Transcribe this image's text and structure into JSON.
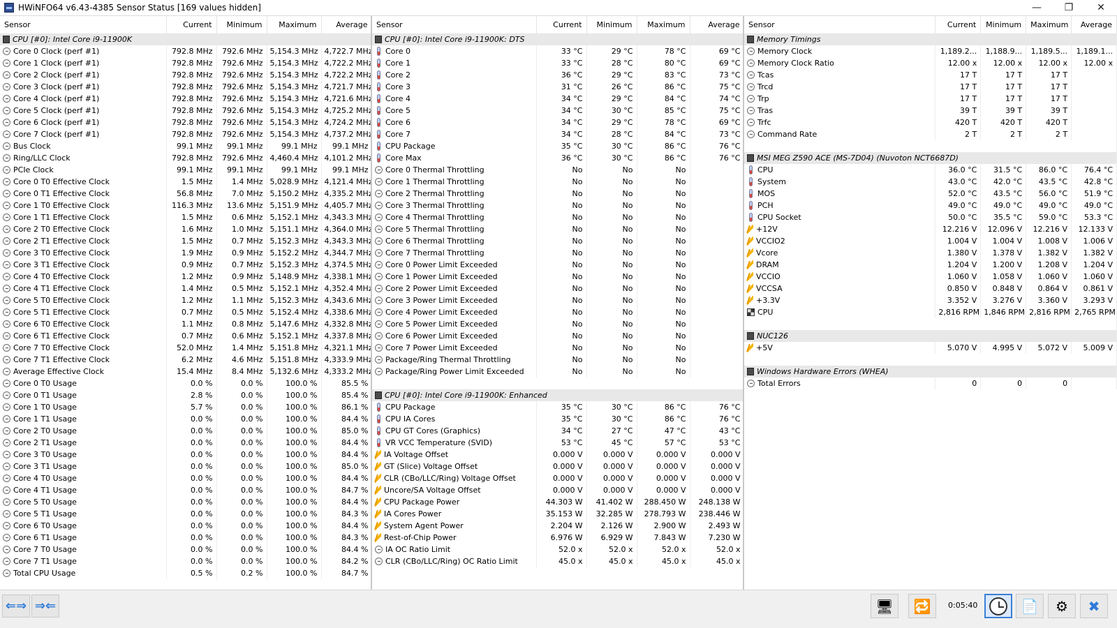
{
  "window": {
    "title": "HWiNFO64 v6.43-4385 Sensor Status [169 values hidden]",
    "minimize": "—",
    "maximize": "❐",
    "close": "✕"
  },
  "columns": [
    "Sensor",
    "Current",
    "Minimum",
    "Maximum",
    "Average"
  ],
  "pane1": [
    {
      "type": "group",
      "name": "CPU [#0]: Intel Core i9-11900K"
    },
    {
      "icon": "clock",
      "name": "Core 0 Clock (perf #1)",
      "cur": "792.8 MHz",
      "min": "792.6 MHz",
      "max": "5,154.3 MHz",
      "avg": "4,722.7 MHz"
    },
    {
      "icon": "clock",
      "name": "Core 1 Clock (perf #1)",
      "cur": "792.8 MHz",
      "min": "792.6 MHz",
      "max": "5,154.3 MHz",
      "avg": "4,722.2 MHz"
    },
    {
      "icon": "clock",
      "name": "Core 2 Clock (perf #1)",
      "cur": "792.8 MHz",
      "min": "792.6 MHz",
      "max": "5,154.3 MHz",
      "avg": "4,722.2 MHz"
    },
    {
      "icon": "clock",
      "name": "Core 3 Clock (perf #1)",
      "cur": "792.8 MHz",
      "min": "792.6 MHz",
      "max": "5,154.3 MHz",
      "avg": "4,721.7 MHz"
    },
    {
      "icon": "clock",
      "name": "Core 4 Clock (perf #1)",
      "cur": "792.8 MHz",
      "min": "792.6 MHz",
      "max": "5,154.3 MHz",
      "avg": "4,721.6 MHz"
    },
    {
      "icon": "clock",
      "name": "Core 5 Clock (perf #1)",
      "cur": "792.8 MHz",
      "min": "792.6 MHz",
      "max": "5,154.3 MHz",
      "avg": "4,725.2 MHz"
    },
    {
      "icon": "clock",
      "name": "Core 6 Clock (perf #1)",
      "cur": "792.8 MHz",
      "min": "792.6 MHz",
      "max": "5,154.3 MHz",
      "avg": "4,724.2 MHz"
    },
    {
      "icon": "clock",
      "name": "Core 7 Clock (perf #1)",
      "cur": "792.8 MHz",
      "min": "792.6 MHz",
      "max": "5,154.3 MHz",
      "avg": "4,737.2 MHz"
    },
    {
      "icon": "clock",
      "name": "Bus Clock",
      "cur": "99.1 MHz",
      "min": "99.1 MHz",
      "max": "99.1 MHz",
      "avg": "99.1 MHz"
    },
    {
      "icon": "clock",
      "name": "Ring/LLC Clock",
      "cur": "792.8 MHz",
      "min": "792.6 MHz",
      "max": "4,460.4 MHz",
      "avg": "4,101.2 MHz"
    },
    {
      "icon": "clock",
      "name": "PCIe Clock",
      "cur": "99.1 MHz",
      "min": "99.1 MHz",
      "max": "99.1 MHz",
      "avg": "99.1 MHz"
    },
    {
      "icon": "clock",
      "name": "Core 0 T0 Effective Clock",
      "cur": "1.5 MHz",
      "min": "1.4 MHz",
      "max": "5,028.9 MHz",
      "avg": "4,121.4 MHz"
    },
    {
      "icon": "clock",
      "name": "Core 0 T1 Effective Clock",
      "cur": "56.8 MHz",
      "min": "7.0 MHz",
      "max": "5,150.2 MHz",
      "avg": "4,335.2 MHz"
    },
    {
      "icon": "clock",
      "name": "Core 1 T0 Effective Clock",
      "cur": "116.3 MHz",
      "min": "13.6 MHz",
      "max": "5,151.9 MHz",
      "avg": "4,405.7 MHz"
    },
    {
      "icon": "clock",
      "name": "Core 1 T1 Effective Clock",
      "cur": "1.5 MHz",
      "min": "0.6 MHz",
      "max": "5,152.1 MHz",
      "avg": "4,343.3 MHz"
    },
    {
      "icon": "clock",
      "name": "Core 2 T0 Effective Clock",
      "cur": "1.6 MHz",
      "min": "1.0 MHz",
      "max": "5,151.1 MHz",
      "avg": "4,364.0 MHz"
    },
    {
      "icon": "clock",
      "name": "Core 2 T1 Effective Clock",
      "cur": "1.5 MHz",
      "min": "0.7 MHz",
      "max": "5,152.3 MHz",
      "avg": "4,343.3 MHz"
    },
    {
      "icon": "clock",
      "name": "Core 3 T0 Effective Clock",
      "cur": "1.9 MHz",
      "min": "0.9 MHz",
      "max": "5,152.2 MHz",
      "avg": "4,344.7 MHz"
    },
    {
      "icon": "clock",
      "name": "Core 3 T1 Effective Clock",
      "cur": "0.9 MHz",
      "min": "0.7 MHz",
      "max": "5,152.3 MHz",
      "avg": "4,374.5 MHz"
    },
    {
      "icon": "clock",
      "name": "Core 4 T0 Effective Clock",
      "cur": "1.2 MHz",
      "min": "0.9 MHz",
      "max": "5,148.9 MHz",
      "avg": "4,338.1 MHz"
    },
    {
      "icon": "clock",
      "name": "Core 4 T1 Effective Clock",
      "cur": "1.4 MHz",
      "min": "0.5 MHz",
      "max": "5,152.1 MHz",
      "avg": "4,352.4 MHz"
    },
    {
      "icon": "clock",
      "name": "Core 5 T0 Effective Clock",
      "cur": "1.2 MHz",
      "min": "1.1 MHz",
      "max": "5,152.3 MHz",
      "avg": "4,343.6 MHz"
    },
    {
      "icon": "clock",
      "name": "Core 5 T1 Effective Clock",
      "cur": "0.7 MHz",
      "min": "0.5 MHz",
      "max": "5,152.4 MHz",
      "avg": "4,338.6 MHz"
    },
    {
      "icon": "clock",
      "name": "Core 6 T0 Effective Clock",
      "cur": "1.1 MHz",
      "min": "0.8 MHz",
      "max": "5,147.6 MHz",
      "avg": "4,332.8 MHz"
    },
    {
      "icon": "clock",
      "name": "Core 6 T1 Effective Clock",
      "cur": "0.7 MHz",
      "min": "0.6 MHz",
      "max": "5,152.1 MHz",
      "avg": "4,337.8 MHz"
    },
    {
      "icon": "clock",
      "name": "Core 7 T0 Effective Clock",
      "cur": "52.0 MHz",
      "min": "1.4 MHz",
      "max": "5,151.8 MHz",
      "avg": "4,321.1 MHz"
    },
    {
      "icon": "clock",
      "name": "Core 7 T1 Effective Clock",
      "cur": "6.2 MHz",
      "min": "4.6 MHz",
      "max": "5,151.8 MHz",
      "avg": "4,333.9 MHz"
    },
    {
      "icon": "clock",
      "name": "Average Effective Clock",
      "cur": "15.4 MHz",
      "min": "8.4 MHz",
      "max": "5,132.6 MHz",
      "avg": "4,333.2 MHz"
    },
    {
      "icon": "clock",
      "name": "Core 0 T0 Usage",
      "cur": "0.0 %",
      "min": "0.0 %",
      "max": "100.0 %",
      "avg": "85.5 %"
    },
    {
      "icon": "clock",
      "name": "Core 0 T1 Usage",
      "cur": "2.8 %",
      "min": "0.0 %",
      "max": "100.0 %",
      "avg": "85.4 %"
    },
    {
      "icon": "clock",
      "name": "Core 1 T0 Usage",
      "cur": "5.7 %",
      "min": "0.0 %",
      "max": "100.0 %",
      "avg": "86.1 %"
    },
    {
      "icon": "clock",
      "name": "Core 1 T1 Usage",
      "cur": "0.0 %",
      "min": "0.0 %",
      "max": "100.0 %",
      "avg": "84.4 %"
    },
    {
      "icon": "clock",
      "name": "Core 2 T0 Usage",
      "cur": "0.0 %",
      "min": "0.0 %",
      "max": "100.0 %",
      "avg": "85.0 %"
    },
    {
      "icon": "clock",
      "name": "Core 2 T1 Usage",
      "cur": "0.0 %",
      "min": "0.0 %",
      "max": "100.0 %",
      "avg": "84.4 %"
    },
    {
      "icon": "clock",
      "name": "Core 3 T0 Usage",
      "cur": "0.0 %",
      "min": "0.0 %",
      "max": "100.0 %",
      "avg": "84.4 %"
    },
    {
      "icon": "clock",
      "name": "Core 3 T1 Usage",
      "cur": "0.0 %",
      "min": "0.0 %",
      "max": "100.0 %",
      "avg": "85.0 %"
    },
    {
      "icon": "clock",
      "name": "Core 4 T0 Usage",
      "cur": "0.0 %",
      "min": "0.0 %",
      "max": "100.0 %",
      "avg": "84.4 %"
    },
    {
      "icon": "clock",
      "name": "Core 4 T1 Usage",
      "cur": "0.0 %",
      "min": "0.0 %",
      "max": "100.0 %",
      "avg": "84.7 %"
    },
    {
      "icon": "clock",
      "name": "Core 5 T0 Usage",
      "cur": "0.0 %",
      "min": "0.0 %",
      "max": "100.0 %",
      "avg": "84.4 %"
    },
    {
      "icon": "clock",
      "name": "Core 5 T1 Usage",
      "cur": "0.0 %",
      "min": "0.0 %",
      "max": "100.0 %",
      "avg": "84.3 %"
    },
    {
      "icon": "clock",
      "name": "Core 6 T0 Usage",
      "cur": "0.0 %",
      "min": "0.0 %",
      "max": "100.0 %",
      "avg": "84.4 %"
    },
    {
      "icon": "clock",
      "name": "Core 6 T1 Usage",
      "cur": "0.0 %",
      "min": "0.0 %",
      "max": "100.0 %",
      "avg": "84.3 %"
    },
    {
      "icon": "clock",
      "name": "Core 7 T0 Usage",
      "cur": "0.0 %",
      "min": "0.0 %",
      "max": "100.0 %",
      "avg": "84.4 %"
    },
    {
      "icon": "clock",
      "name": "Core 7 T1 Usage",
      "cur": "0.0 %",
      "min": "0.0 %",
      "max": "100.0 %",
      "avg": "84.2 %"
    },
    {
      "icon": "clock",
      "name": "Total CPU Usage",
      "cur": "0.5 %",
      "min": "0.2 %",
      "max": "100.0 %",
      "avg": "84.7 %"
    }
  ],
  "pane2": [
    {
      "type": "group",
      "name": "CPU [#0]: Intel Core i9-11900K: DTS"
    },
    {
      "icon": "temp",
      "name": "Core 0",
      "cur": "33 °C",
      "min": "29 °C",
      "max": "78 °C",
      "avg": "69 °C"
    },
    {
      "icon": "temp",
      "name": "Core 1",
      "cur": "33 °C",
      "min": "28 °C",
      "max": "80 °C",
      "avg": "69 °C"
    },
    {
      "icon": "temp",
      "name": "Core 2",
      "cur": "36 °C",
      "min": "29 °C",
      "max": "83 °C",
      "avg": "73 °C"
    },
    {
      "icon": "temp",
      "name": "Core 3",
      "cur": "31 °C",
      "min": "26 °C",
      "max": "86 °C",
      "avg": "75 °C"
    },
    {
      "icon": "temp",
      "name": "Core 4",
      "cur": "34 °C",
      "min": "29 °C",
      "max": "84 °C",
      "avg": "74 °C"
    },
    {
      "icon": "temp",
      "name": "Core 5",
      "cur": "34 °C",
      "min": "30 °C",
      "max": "85 °C",
      "avg": "75 °C"
    },
    {
      "icon": "temp",
      "name": "Core 6",
      "cur": "34 °C",
      "min": "29 °C",
      "max": "78 °C",
      "avg": "69 °C"
    },
    {
      "icon": "temp",
      "name": "Core 7",
      "cur": "34 °C",
      "min": "28 °C",
      "max": "84 °C",
      "avg": "73 °C"
    },
    {
      "icon": "temp",
      "name": "CPU Package",
      "cur": "35 °C",
      "min": "30 °C",
      "max": "86 °C",
      "avg": "76 °C"
    },
    {
      "icon": "temp",
      "name": "Core Max",
      "cur": "36 °C",
      "min": "30 °C",
      "max": "86 °C",
      "avg": "76 °C"
    },
    {
      "icon": "clock",
      "name": "Core 0 Thermal Throttling",
      "cur": "No",
      "min": "No",
      "max": "No",
      "avg": ""
    },
    {
      "icon": "clock",
      "name": "Core 1 Thermal Throttling",
      "cur": "No",
      "min": "No",
      "max": "No",
      "avg": ""
    },
    {
      "icon": "clock",
      "name": "Core 2 Thermal Throttling",
      "cur": "No",
      "min": "No",
      "max": "No",
      "avg": ""
    },
    {
      "icon": "clock",
      "name": "Core 3 Thermal Throttling",
      "cur": "No",
      "min": "No",
      "max": "No",
      "avg": ""
    },
    {
      "icon": "clock",
      "name": "Core 4 Thermal Throttling",
      "cur": "No",
      "min": "No",
      "max": "No",
      "avg": ""
    },
    {
      "icon": "clock",
      "name": "Core 5 Thermal Throttling",
      "cur": "No",
      "min": "No",
      "max": "No",
      "avg": ""
    },
    {
      "icon": "clock",
      "name": "Core 6 Thermal Throttling",
      "cur": "No",
      "min": "No",
      "max": "No",
      "avg": ""
    },
    {
      "icon": "clock",
      "name": "Core 7 Thermal Throttling",
      "cur": "No",
      "min": "No",
      "max": "No",
      "avg": ""
    },
    {
      "icon": "clock",
      "name": "Core 0 Power Limit Exceeded",
      "cur": "No",
      "min": "No",
      "max": "No",
      "avg": ""
    },
    {
      "icon": "clock",
      "name": "Core 1 Power Limit Exceeded",
      "cur": "No",
      "min": "No",
      "max": "No",
      "avg": ""
    },
    {
      "icon": "clock",
      "name": "Core 2 Power Limit Exceeded",
      "cur": "No",
      "min": "No",
      "max": "No",
      "avg": ""
    },
    {
      "icon": "clock",
      "name": "Core 3 Power Limit Exceeded",
      "cur": "No",
      "min": "No",
      "max": "No",
      "avg": ""
    },
    {
      "icon": "clock",
      "name": "Core 4 Power Limit Exceeded",
      "cur": "No",
      "min": "No",
      "max": "No",
      "avg": ""
    },
    {
      "icon": "clock",
      "name": "Core 5 Power Limit Exceeded",
      "cur": "No",
      "min": "No",
      "max": "No",
      "avg": ""
    },
    {
      "icon": "clock",
      "name": "Core 6 Power Limit Exceeded",
      "cur": "No",
      "min": "No",
      "max": "No",
      "avg": ""
    },
    {
      "icon": "clock",
      "name": "Core 7 Power Limit Exceeded",
      "cur": "No",
      "min": "No",
      "max": "No",
      "avg": ""
    },
    {
      "icon": "clock",
      "name": "Package/Ring Thermal Throttling",
      "cur": "No",
      "min": "No",
      "max": "No",
      "avg": ""
    },
    {
      "icon": "clock",
      "name": "Package/Ring Power Limit Exceeded",
      "cur": "No",
      "min": "No",
      "max": "No",
      "avg": ""
    },
    {
      "type": "spacer"
    },
    {
      "type": "group",
      "name": "CPU [#0]: Intel Core i9-11900K: Enhanced"
    },
    {
      "icon": "temp",
      "name": "CPU Package",
      "cur": "35 °C",
      "min": "30 °C",
      "max": "86 °C",
      "avg": "76 °C"
    },
    {
      "icon": "temp",
      "name": "CPU IA Cores",
      "cur": "35 °C",
      "min": "30 °C",
      "max": "86 °C",
      "avg": "76 °C"
    },
    {
      "icon": "temp",
      "name": "CPU GT Cores (Graphics)",
      "cur": "34 °C",
      "min": "27 °C",
      "max": "47 °C",
      "avg": "43 °C"
    },
    {
      "icon": "temp",
      "name": "VR VCC Temperature (SVID)",
      "cur": "53 °C",
      "min": "45 °C",
      "max": "57 °C",
      "avg": "53 °C"
    },
    {
      "icon": "volt",
      "name": "IA Voltage Offset",
      "cur": "0.000 V",
      "min": "0.000 V",
      "max": "0.000 V",
      "avg": "0.000 V"
    },
    {
      "icon": "volt",
      "name": "GT (Slice) Voltage Offset",
      "cur": "0.000 V",
      "min": "0.000 V",
      "max": "0.000 V",
      "avg": "0.000 V"
    },
    {
      "icon": "volt",
      "name": "CLR (CBo/LLC/Ring) Voltage Offset",
      "cur": "0.000 V",
      "min": "0.000 V",
      "max": "0.000 V",
      "avg": "0.000 V"
    },
    {
      "icon": "volt",
      "name": "Uncore/SA Voltage Offset",
      "cur": "0.000 V",
      "min": "0.000 V",
      "max": "0.000 V",
      "avg": "0.000 V"
    },
    {
      "icon": "volt",
      "name": "CPU Package Power",
      "cur": "44.303 W",
      "min": "41.402 W",
      "max": "288.450 W",
      "avg": "248.138 W"
    },
    {
      "icon": "volt",
      "name": "IA Cores Power",
      "cur": "35.153 W",
      "min": "32.285 W",
      "max": "278.793 W",
      "avg": "238.446 W"
    },
    {
      "icon": "volt",
      "name": "System Agent Power",
      "cur": "2.204 W",
      "min": "2.126 W",
      "max": "2.900 W",
      "avg": "2.493 W"
    },
    {
      "icon": "volt",
      "name": "Rest-of-Chip Power",
      "cur": "6.976 W",
      "min": "6.929 W",
      "max": "7.843 W",
      "avg": "7.230 W"
    },
    {
      "icon": "clock",
      "name": "IA OC Ratio Limit",
      "cur": "52.0 x",
      "min": "52.0 x",
      "max": "52.0 x",
      "avg": "52.0 x"
    },
    {
      "icon": "clock",
      "name": "CLR (CBo/LLC/Ring) OC Ratio Limit",
      "cur": "45.0 x",
      "min": "45.0 x",
      "max": "45.0 x",
      "avg": "45.0 x"
    }
  ],
  "pane3": [
    {
      "type": "group",
      "name": "Memory Timings"
    },
    {
      "icon": "clock",
      "name": "Memory Clock",
      "cur": "1,189.2...",
      "min": "1,188.9...",
      "max": "1,189.5...",
      "avg": "1,189.1..."
    },
    {
      "icon": "clock",
      "name": "Memory Clock Ratio",
      "cur": "12.00 x",
      "min": "12.00 x",
      "max": "12.00 x",
      "avg": "12.00 x"
    },
    {
      "icon": "clock",
      "name": "Tcas",
      "cur": "17 T",
      "min": "17 T",
      "max": "17 T",
      "avg": ""
    },
    {
      "icon": "clock",
      "name": "Trcd",
      "cur": "17 T",
      "min": "17 T",
      "max": "17 T",
      "avg": ""
    },
    {
      "icon": "clock",
      "name": "Trp",
      "cur": "17 T",
      "min": "17 T",
      "max": "17 T",
      "avg": ""
    },
    {
      "icon": "clock",
      "name": "Tras",
      "cur": "39 T",
      "min": "39 T",
      "max": "39 T",
      "avg": ""
    },
    {
      "icon": "clock",
      "name": "Trfc",
      "cur": "420 T",
      "min": "420 T",
      "max": "420 T",
      "avg": ""
    },
    {
      "icon": "clock",
      "name": "Command Rate",
      "cur": "2 T",
      "min": "2 T",
      "max": "2 T",
      "avg": ""
    },
    {
      "type": "spacer"
    },
    {
      "type": "group",
      "name": "MSI MEG Z590 ACE (MS-7D04) (Nuvoton NCT6687D)"
    },
    {
      "icon": "temp",
      "name": "CPU",
      "cur": "36.0 °C",
      "min": "31.5 °C",
      "max": "86.0 °C",
      "avg": "76.4 °C"
    },
    {
      "icon": "temp",
      "name": "System",
      "cur": "43.0 °C",
      "min": "42.0 °C",
      "max": "43.5 °C",
      "avg": "42.8 °C"
    },
    {
      "icon": "temp",
      "name": "MOS",
      "cur": "52.0 °C",
      "min": "43.5 °C",
      "max": "56.0 °C",
      "avg": "51.9 °C"
    },
    {
      "icon": "temp",
      "name": "PCH",
      "cur": "49.0 °C",
      "min": "49.0 °C",
      "max": "49.0 °C",
      "avg": "49.0 °C"
    },
    {
      "icon": "temp",
      "name": "CPU Socket",
      "cur": "50.0 °C",
      "min": "35.5 °C",
      "max": "59.0 °C",
      "avg": "53.3 °C"
    },
    {
      "icon": "volt",
      "name": "+12V",
      "cur": "12.216 V",
      "min": "12.096 V",
      "max": "12.216 V",
      "avg": "12.133 V"
    },
    {
      "icon": "volt",
      "name": "VCCIO2",
      "cur": "1.004 V",
      "min": "1.004 V",
      "max": "1.008 V",
      "avg": "1.006 V"
    },
    {
      "icon": "volt",
      "name": "Vcore",
      "cur": "1.380 V",
      "min": "1.378 V",
      "max": "1.382 V",
      "avg": "1.382 V"
    },
    {
      "icon": "volt",
      "name": "DRAM",
      "cur": "1.204 V",
      "min": "1.200 V",
      "max": "1.208 V",
      "avg": "1.204 V"
    },
    {
      "icon": "volt",
      "name": "VCCIO",
      "cur": "1.060 V",
      "min": "1.058 V",
      "max": "1.060 V",
      "avg": "1.060 V"
    },
    {
      "icon": "volt",
      "name": "VCCSA",
      "cur": "0.850 V",
      "min": "0.848 V",
      "max": "0.864 V",
      "avg": "0.861 V"
    },
    {
      "icon": "volt",
      "name": "+3.3V",
      "cur": "3.352 V",
      "min": "3.276 V",
      "max": "3.360 V",
      "avg": "3.293 V"
    },
    {
      "icon": "fan",
      "name": "CPU",
      "cur": "2,816 RPM",
      "min": "1,846 RPM",
      "max": "2,816 RPM",
      "avg": "2,765 RPM"
    },
    {
      "type": "spacer"
    },
    {
      "type": "group",
      "name": "NUC126"
    },
    {
      "icon": "volt",
      "name": "+5V",
      "cur": "5.070 V",
      "min": "4.995 V",
      "max": "5.072 V",
      "avg": "5.009 V"
    },
    {
      "type": "spacer"
    },
    {
      "type": "group",
      "name": "Windows Hardware Errors (WHEA)"
    },
    {
      "icon": "clock",
      "name": "Total Errors",
      "cur": "0",
      "min": "0",
      "max": "0",
      "avg": ""
    }
  ],
  "toolbar": {
    "timer": "0:05:40",
    "nav_left": "⇐⇒",
    "nav_right": "⇒⇐"
  },
  "colors": {
    "group_bg": "#e8e8e8",
    "accent": "#2f7bd8"
  }
}
